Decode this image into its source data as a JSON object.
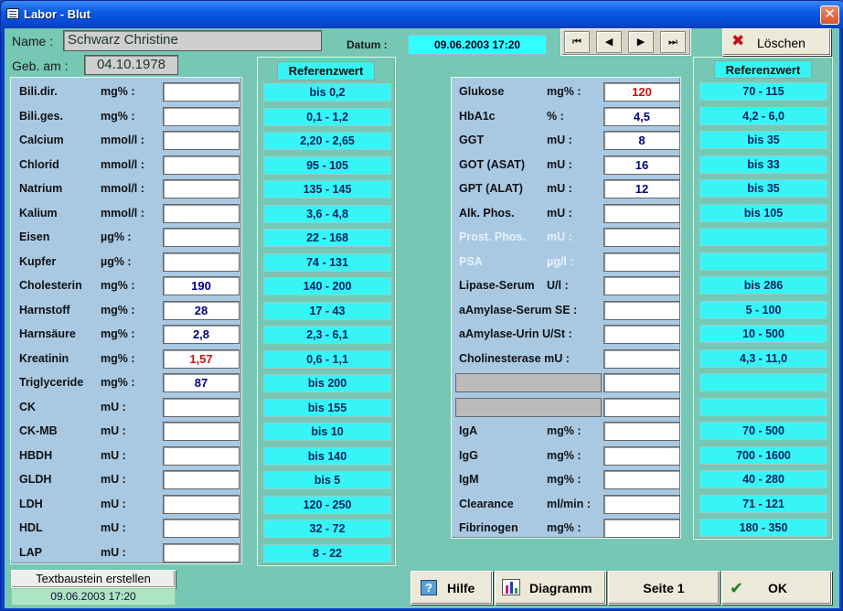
{
  "window": {
    "title": "Labor - Blut",
    "close": "✕"
  },
  "patient": {
    "name_label": "Name :",
    "name": "Schwarz Christine",
    "dob_label": "Geb. am :",
    "dob": "04.10.1978"
  },
  "datum": {
    "label": "Datum :",
    "value": "09.06.2003 17:20"
  },
  "nav": {
    "first": "⏮",
    "prev": "◀",
    "next": "▶",
    "last": "⏭"
  },
  "loeschen": {
    "label": "Löschen",
    "icon": "delete-icon"
  },
  "ref_header": "Referenzwert",
  "left_rows": [
    {
      "name": "Bili.dir.",
      "unit": "mg% :",
      "value": "",
      "ref": "bis 0,2"
    },
    {
      "name": "Bili.ges.",
      "unit": "mg% :",
      "value": "",
      "ref": "0,1 - 1,2"
    },
    {
      "name": "Calcium",
      "unit": "mmol/l :",
      "value": "",
      "ref": "2,20 - 2,65"
    },
    {
      "name": "Chlorid",
      "unit": "mmol/l :",
      "value": "",
      "ref": "95 - 105"
    },
    {
      "name": "Natrium",
      "unit": "mmol/l :",
      "value": "",
      "ref": "135 - 145"
    },
    {
      "name": "Kalium",
      "unit": "mmol/l :",
      "value": "",
      "ref": "3,6 - 4,8"
    },
    {
      "name": "Eisen",
      "unit": "µg% :",
      "value": "",
      "ref": "22 - 168"
    },
    {
      "name": "Kupfer",
      "unit": "µg% :",
      "value": "",
      "ref": "74 - 131"
    },
    {
      "name": "Cholesterin",
      "unit": "mg% :",
      "value": "190",
      "ref": "140 - 200"
    },
    {
      "name": "Harnstoff",
      "unit": "mg% :",
      "value": "28",
      "ref": "17 - 43"
    },
    {
      "name": "Harnsäure",
      "unit": "mg% :",
      "value": "2,8",
      "ref": "2,3 - 6,1"
    },
    {
      "name": "Kreatinin",
      "unit": "mg% :",
      "value": "1,57",
      "ref": "0,6 - 1,1",
      "flag": "high"
    },
    {
      "name": "Triglyceride",
      "unit": "mg% :",
      "value": "87",
      "ref": "bis 200"
    },
    {
      "name": "CK",
      "unit": "mU :",
      "value": "",
      "ref": "bis 155"
    },
    {
      "name": "CK-MB",
      "unit": "mU :",
      "value": "",
      "ref": "bis 10"
    },
    {
      "name": "HBDH",
      "unit": "mU :",
      "value": "",
      "ref": "bis 140"
    },
    {
      "name": "GLDH",
      "unit": "mU :",
      "value": "",
      "ref": "bis 5"
    },
    {
      "name": "LDH",
      "unit": "mU :",
      "value": "",
      "ref": "120 - 250"
    },
    {
      "name": "HDL",
      "unit": "mU :",
      "value": "",
      "ref": "32 - 72"
    },
    {
      "name": "LAP",
      "unit": "mU :",
      "value": "",
      "ref": "8 - 22"
    }
  ],
  "right_rows": [
    {
      "name": "Glukose",
      "unit": "mg% :",
      "value": "120",
      "ref": "70 - 115",
      "flag": "high"
    },
    {
      "name": "HbA1c",
      "unit": "% :",
      "value": "4,5",
      "ref": "4,2 - 6,0"
    },
    {
      "name": "GGT",
      "unit": "mU :",
      "value": "8",
      "ref": "bis 35"
    },
    {
      "name": "GOT (ASAT)",
      "unit": "mU :",
      "value": "16",
      "ref": "bis 33"
    },
    {
      "name": "GPT (ALAT)",
      "unit": "mU :",
      "value": "12",
      "ref": "bis 35"
    },
    {
      "name": "Alk. Phos.",
      "unit": "mU :",
      "value": "",
      "ref": "bis 105"
    },
    {
      "name": "Prost. Phos.",
      "unit": "mU :",
      "value": "",
      "ref": "",
      "muted": true
    },
    {
      "name": "PSA",
      "unit": "µg/l :",
      "value": "",
      "ref": "",
      "muted": true
    },
    {
      "name": "Lipase-Serum",
      "unit": "U/l :",
      "value": "",
      "ref": "bis 286"
    },
    {
      "name": "aAmylase-Serum SE :",
      "unit": "",
      "value": "",
      "ref": "5 - 100"
    },
    {
      "name": "aAmylase-Urin U/St :",
      "unit": "",
      "value": "",
      "ref": "10 - 500"
    },
    {
      "name": "Cholinesterase  mU :",
      "unit": "",
      "value": "",
      "ref": "4,3 - 11,0"
    },
    {
      "name": "",
      "unit": "",
      "value": "",
      "ref": "",
      "grey": true
    },
    {
      "name": "",
      "unit": "",
      "value": "",
      "ref": "",
      "grey": true
    },
    {
      "name": "IgA",
      "unit": "mg% :",
      "value": "",
      "ref": "70 - 500"
    },
    {
      "name": "IgG",
      "unit": "mg% :",
      "value": "",
      "ref": "700 - 1600"
    },
    {
      "name": "IgM",
      "unit": "mg% :",
      "value": "",
      "ref": "40 - 280"
    },
    {
      "name": "Clearance",
      "unit": "ml/min :",
      "value": "",
      "ref": "71 - 121"
    },
    {
      "name": "Fibrinogen",
      "unit": "mg% :",
      "value": "",
      "ref": "180 - 350"
    }
  ],
  "textbaustein": {
    "label": "Textbaustein erstellen",
    "date": "09.06.2003 17:20"
  },
  "buttons": {
    "hilfe": "Hilfe",
    "diagramm": "Diagramm",
    "seite": "Seite 1",
    "ok": "OK"
  },
  "colors": {
    "high_value": "#d01010",
    "normal_value": "#000080",
    "reference_bg": "#38f5f5"
  }
}
